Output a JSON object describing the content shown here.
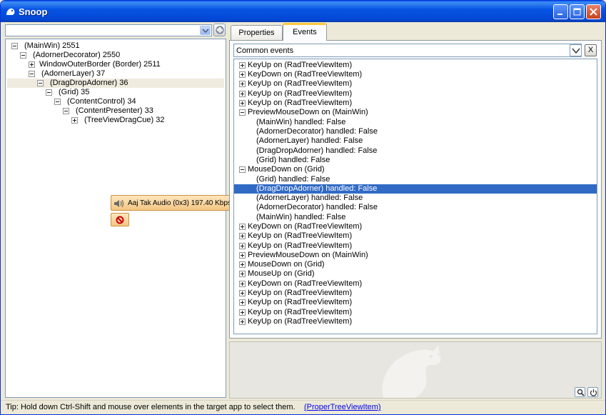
{
  "window": {
    "title": "Snoop"
  },
  "tree": {
    "items": [
      {
        "label": "(MainWin) 2551",
        "expander": "minus"
      },
      {
        "label": "(AdornerDecorator) 2550",
        "expander": "minus"
      },
      {
        "label": "WindowOuterBorder (Border) 2511",
        "expander": "plus"
      },
      {
        "label": "(AdornerLayer) 37",
        "expander": "minus"
      },
      {
        "label": "(DragDropAdorner) 36",
        "expander": "minus",
        "selected": true
      },
      {
        "label": "(Grid) 35",
        "expander": "minus"
      },
      {
        "label": "(ContentControl) 34",
        "expander": "minus"
      },
      {
        "label": "(ContentPresenter) 33",
        "expander": "minus"
      },
      {
        "label": "(TreeViewDragCue) 32",
        "expander": "plus"
      }
    ]
  },
  "popup": {
    "text": "Aaj Tak Audio (0x3) 197.40 Kbps"
  },
  "tabs": {
    "properties": "Properties",
    "events": "Events"
  },
  "events": {
    "filter": "Common events",
    "clear_label": "X",
    "rows": [
      {
        "text": "KeyUp on (RadTreeViewItem)",
        "expander": "plus"
      },
      {
        "text": "KeyDown on (RadTreeViewItem)",
        "expander": "plus"
      },
      {
        "text": "KeyUp on (RadTreeViewItem)",
        "expander": "plus"
      },
      {
        "text": "KeyUp on (RadTreeViewItem)",
        "expander": "plus"
      },
      {
        "text": "KeyUp on (RadTreeViewItem)",
        "expander": "plus"
      },
      {
        "text": "PreviewMouseDown on (MainWin)",
        "expander": "minus"
      },
      {
        "text": "(MainWin) handled: False",
        "child": true
      },
      {
        "text": "(AdornerDecorator) handled: False",
        "child": true
      },
      {
        "text": "(AdornerLayer) handled: False",
        "child": true
      },
      {
        "text": "(DragDropAdorner) handled: False",
        "child": true
      },
      {
        "text": "(Grid) handled: False",
        "child": true
      },
      {
        "text": "MouseDown on (Grid)",
        "expander": "minus"
      },
      {
        "text": "(Grid) handled: False",
        "child": true
      },
      {
        "text": "(DragDropAdorner) handled: False",
        "child": true,
        "selected": true
      },
      {
        "text": "(AdornerLayer) handled: False",
        "child": true
      },
      {
        "text": "(AdornerDecorator) handled: False",
        "child": true
      },
      {
        "text": "(MainWin) handled: False",
        "child": true
      },
      {
        "text": "KeyDown on (RadTreeViewItem)",
        "expander": "plus"
      },
      {
        "text": "KeyUp on (RadTreeViewItem)",
        "expander": "plus"
      },
      {
        "text": "KeyUp on (RadTreeViewItem)",
        "expander": "plus"
      },
      {
        "text": "PreviewMouseDown on (MainWin)",
        "expander": "plus"
      },
      {
        "text": "MouseDown on (Grid)",
        "expander": "plus"
      },
      {
        "text": "MouseUp on (Grid)",
        "expander": "plus"
      },
      {
        "text": "KeyDown on (RadTreeViewItem)",
        "expander": "plus"
      },
      {
        "text": "KeyUp on (RadTreeViewItem)",
        "expander": "plus"
      },
      {
        "text": "KeyUp on (RadTreeViewItem)",
        "expander": "plus"
      },
      {
        "text": "KeyUp on (RadTreeViewItem)",
        "expander": "plus"
      },
      {
        "text": "KeyUp on (RadTreeViewItem)",
        "expander": "plus"
      }
    ]
  },
  "status": {
    "tip": "Tip: Hold down Ctrl-Shift and mouse over elements in the target app to select them.",
    "link": "(ProperTreeViewItem)"
  }
}
